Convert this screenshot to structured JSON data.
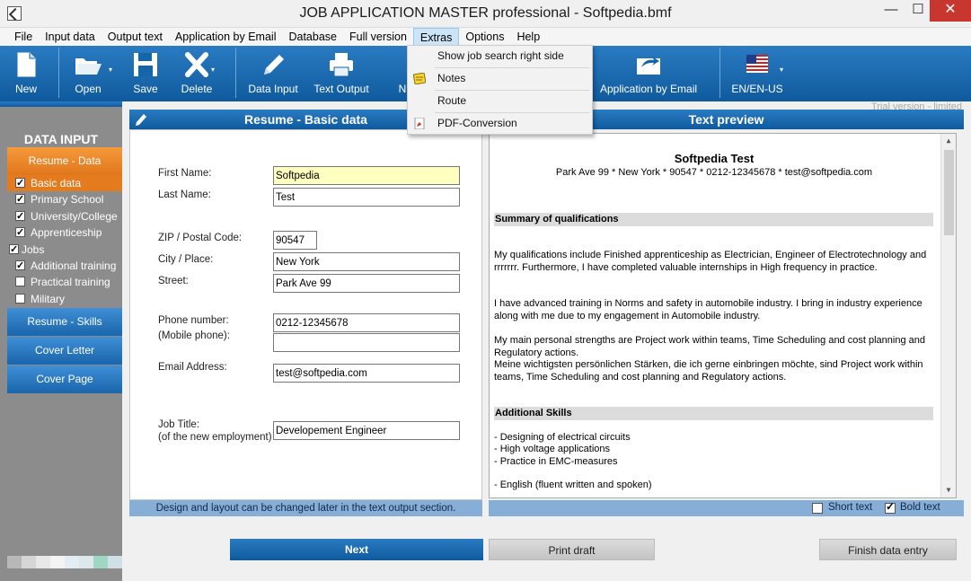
{
  "window": {
    "title": "JOB APPLICATION MASTER professional - Softpedia.bmf",
    "minimize": "—",
    "maximize": "☐",
    "close": "✕"
  },
  "menu": [
    {
      "label": "File"
    },
    {
      "label": "Input data"
    },
    {
      "label": "Output text"
    },
    {
      "label": "Application by Email"
    },
    {
      "label": "Database"
    },
    {
      "label": "Full version"
    },
    {
      "label": "Extras"
    },
    {
      "label": "Options"
    },
    {
      "label": "Help"
    }
  ],
  "extras_menu": {
    "items": [
      {
        "label": "Show job search right side",
        "icon": ""
      },
      {
        "label": "Notes",
        "icon": "notes-icon"
      },
      {
        "label": "Route",
        "icon": ""
      },
      {
        "label": "PDF-Conversion",
        "icon": "pdf-icon"
      }
    ]
  },
  "toolbar": {
    "new": "New",
    "open": "Open",
    "save": "Save",
    "delete": "Delete",
    "data_input": "Data Input",
    "text_output": "Text Output",
    "partial": "N",
    "application_by_email": "Application by Email",
    "language": "EN/EN-US"
  },
  "sidebar": {
    "header": "DATA INPUT",
    "resume_data": "Resume - Data",
    "items": [
      {
        "label": "Basic data",
        "checked": true
      },
      {
        "label": "Primary School",
        "checked": true
      },
      {
        "label": "University/College",
        "checked": true
      },
      {
        "label": "Apprenticeship",
        "checked": true
      },
      {
        "label": "Jobs",
        "checked": true
      },
      {
        "label": "Additional training",
        "checked": true
      },
      {
        "label": "Practical training",
        "checked": false
      },
      {
        "label": "Military",
        "checked": false
      }
    ],
    "resume_skills": "Resume - Skills",
    "cover_letter": "Cover Letter",
    "cover_page": "Cover Page",
    "swatches": [
      "#b8b8b8",
      "#d6d6d6",
      "#e8e8e8",
      "#f4f4f4",
      "#e2eef3",
      "#dce8ec",
      "#9fd6c4",
      "#cfe0e6"
    ]
  },
  "trial_text": "Trial version - limited",
  "form": {
    "header": "Resume - Basic data",
    "first_name_label": "First Name:",
    "first_name": "Softpedia",
    "last_name_label": "Last Name:",
    "last_name": "Test",
    "zip_label": "ZIP / Postal Code:",
    "zip": "90547",
    "city_label": "City / Place:",
    "city": "New York",
    "street_label": "Street:",
    "street": "Park Ave 99",
    "phone_label": "Phone number:",
    "phone": "0212-12345678",
    "mobile_label": "(Mobile phone):",
    "mobile": "",
    "email_label": "Email Address:",
    "email": "test@softpedia.com",
    "job_title_label": "Job Title:",
    "job_title_sub": "(of the new employment)",
    "job_title": "Developement Engineer",
    "info": "Design and layout can be changed later in the text output section."
  },
  "preview": {
    "header": "Text preview",
    "name": "Softpedia Test",
    "address": "Park Ave 99 * New York * 90547 * 0212-12345678 * test@softpedia.com",
    "summary_heading": "Summary of qualifications",
    "p1": "My qualifications include Finished apprenticeship as Electrician, Engineer of Electrotechnology  and rrrrrrr. Furthermore, I have completed valuable internships in High frequency in practice.",
    "p2": "I have advanced training in Norms and safety in automobile industry. I bring in industry experience along with me due to my engagement in Automobile industry.",
    "p3": "My main personal strengths are Project work within teams, Time Scheduling and cost planning and Regulatory actions.",
    "p4": "Meine wichtigsten persönlichen Stärken, die ich gerne einbringen möchte, sind Project work within teams, Time Scheduling and cost planning and Regulatory actions.",
    "skills_heading": "Additional Skills",
    "skills": [
      "- Designing of electrical circuits",
      "- High voltage applications",
      "- Practice in EMC-measures"
    ],
    "english": "- English (fluent written and spoken)",
    "short_text": "Short text",
    "short_checked": false,
    "bold_text": "Bold text",
    "bold_checked": true
  },
  "buttons": {
    "next": "Next",
    "print_draft": "Print draft",
    "finish": "Finish data entry"
  },
  "colors": {
    "accent_blue": "#1565a9",
    "active_orange": "#e47b1f",
    "info_bar": "#86aed6"
  }
}
